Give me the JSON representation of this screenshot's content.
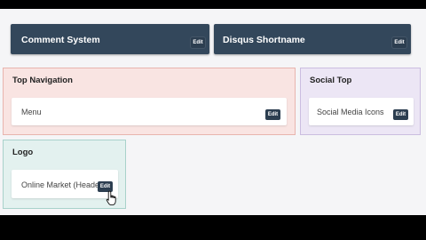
{
  "top_cards": [
    {
      "title": "Comment System",
      "edit_label": "Edit"
    },
    {
      "title": "Disqus Shortname",
      "edit_label": "Edit"
    }
  ],
  "regions": {
    "top_navigation": {
      "title": "Top Navigation",
      "card_text": "Menu",
      "edit_label": "Edit",
      "color": "#f9e4e2"
    },
    "social_top": {
      "title": "Social Top",
      "card_text": "Social Media Icons",
      "edit_label": "Edit",
      "color": "#ece6f5"
    },
    "logo": {
      "title": "Logo",
      "card_text": "Online Market (Header)",
      "edit_label": "Edit",
      "color": "#e3f1ef"
    }
  },
  "icons": {
    "cursor": "hand-pointer-icon"
  }
}
